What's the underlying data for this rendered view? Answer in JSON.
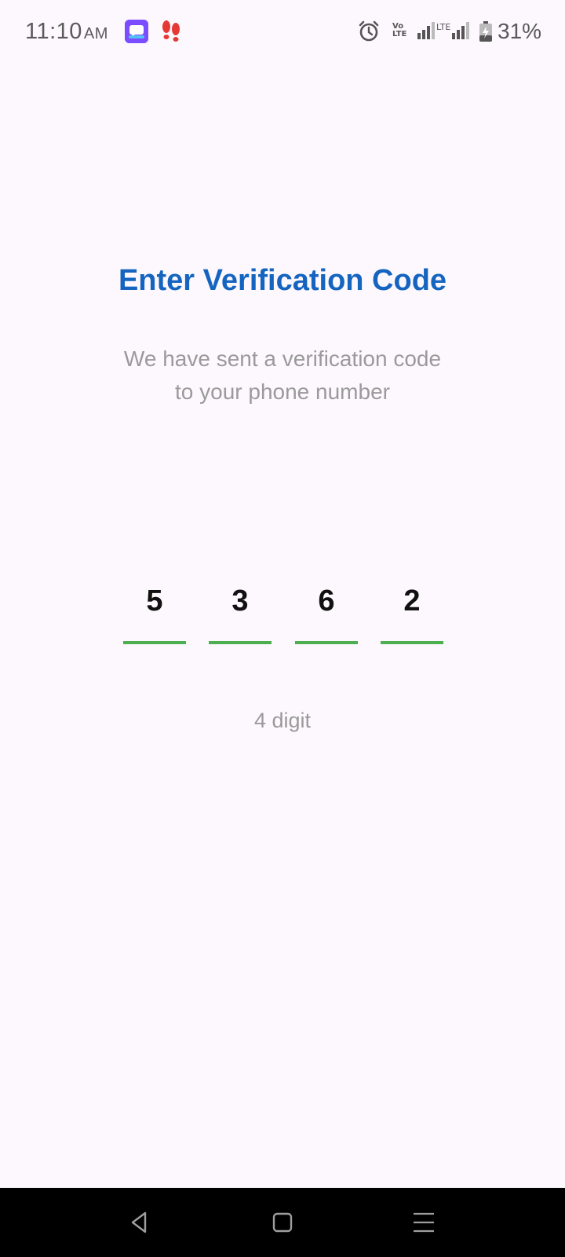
{
  "status_bar": {
    "time": "11:10",
    "ampm": "AM",
    "battery": "31%",
    "network_label": "LTE",
    "volte_top": "Vo",
    "volte_bottom": "LTE",
    "icons": [
      "messaging-notification-icon",
      "steps-notification-icon",
      "alarm-icon",
      "volte-icon",
      "signal-icon",
      "lte-signal-icon",
      "battery-charging-icon"
    ]
  },
  "screen": {
    "title": "Enter Verification Code",
    "subtitle_line1": "We have sent a verification code",
    "subtitle_line2": "to your phone number",
    "code_digits": [
      "5",
      "3",
      "6",
      "2"
    ],
    "hint": "4 digit"
  },
  "colors": {
    "title": "#1565c0",
    "underline": "#4caf50",
    "background": "#fdf8fd",
    "muted_text": "#9a9a9a"
  },
  "nav": {
    "buttons": [
      "back-icon",
      "home-icon",
      "recents-icon"
    ]
  }
}
